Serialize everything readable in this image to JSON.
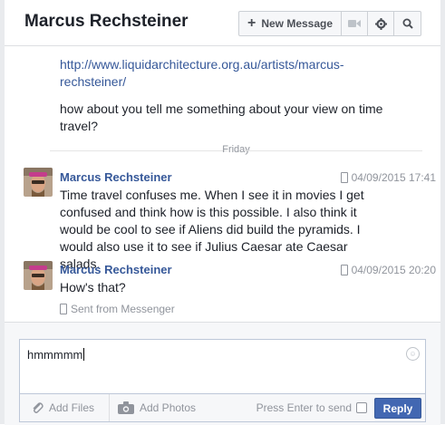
{
  "header": {
    "title": "Marcus Rechsteiner",
    "new_message_label": "New Message",
    "icons": [
      "video-icon",
      "gear-icon",
      "search-icon"
    ]
  },
  "thread": {
    "continuation": {
      "link": "http://www.liquidarchitecture.org.au/artists/marcus-rechsteiner/",
      "text": "how about you tell me something about your view on time travel?"
    },
    "divider_label": "Friday",
    "messages": [
      {
        "sender": "Marcus Rechsteiner",
        "timestamp": "04/09/2015 17:41",
        "text": "Time travel confuses me. When I see it in movies I get confused and think how is this possible. I also think it would be cool to see if Aliens did build the pyramids. I would also use it to see if Julius Caesar ate Caesar salads."
      },
      {
        "sender": "Marcus Rechsteiner",
        "timestamp": "04/09/2015 20:20",
        "text": "How's that?"
      }
    ],
    "sent_from": "Sent from Messenger"
  },
  "composer": {
    "value": "hmmmmm",
    "add_files_label": "Add Files",
    "add_photos_label": "Add Photos",
    "enter_to_send_label": "Press Enter to send",
    "enter_to_send_checked": false,
    "reply_label": "Reply"
  },
  "colors": {
    "link": "#365899",
    "reply_button": "#4267b2",
    "muted": "#90949c"
  }
}
